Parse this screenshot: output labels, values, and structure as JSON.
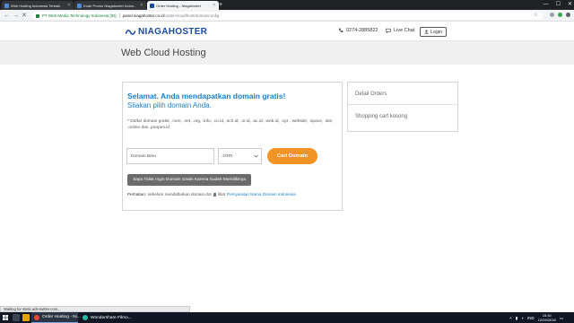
{
  "browser": {
    "tabs": [
      {
        "title": "Web Hosting Indonesia Terbaik",
        "active": false
      },
      {
        "title": "Kode Promo Niagahoster Indon...",
        "active": false
      },
      {
        "title": "Order Hosting - Niagahoster",
        "active": true
      }
    ],
    "new_tab": "+",
    "org": "PT Web Media Technology Indonesia [ID]",
    "url_host": "panel.niagahoster.co.id",
    "url_path": "/order/cloud/host/domainconfig"
  },
  "header": {
    "logo": "NIAGAHOSTER",
    "phone": "0274-2885822",
    "live_chat": "Live Chat",
    "login": "Login"
  },
  "page": {
    "title": "Web Cloud Hosting"
  },
  "domain_card": {
    "headline": "Selamat. Anda mendapatkan domain gratis!",
    "subheadline": "Silakan pilih domain Anda.",
    "note": "* Daftar domain gratis: .com, .net, .org, .info, .co.id, .sch.id, .or.id, .ac.id, .web.id, .xyz, .website, .space, .site, .online dan .ponpes.id",
    "input_placeholder": "Domain Baru",
    "tld_selected": ".com",
    "search_button": "Cari Domain",
    "no_free_domain_button": "Saya Tidak Ingin Domain Gratis Karena Sudah Memilikinya",
    "attention_label": "Perhatian:",
    "attention_text": "sebelum mendaftarkan domain dot",
    "attention_text_2": "lihat",
    "attention_link": "Persyaratan Nama Domain Indonesia"
  },
  "order_card": {
    "title": "Detail Orders",
    "empty": "Shopping cart kosong"
  },
  "status_bar": "Waiting for static.ads-twitter.com...",
  "taskbar": {
    "apps": [
      {
        "label": "Order Hosting - Ni...",
        "active": true
      },
      {
        "label": "Wondershare Filmo...",
        "active": false
      }
    ],
    "lang": "IND",
    "time": "15:30",
    "date": "12/09/2018"
  },
  "colors": {
    "brand_blue": "#1b7fc4",
    "logo_blue": "#1a4a9c",
    "search_orange": "#f29325",
    "secondary_button": "#6b6b6b",
    "taskbar": "#101623"
  }
}
